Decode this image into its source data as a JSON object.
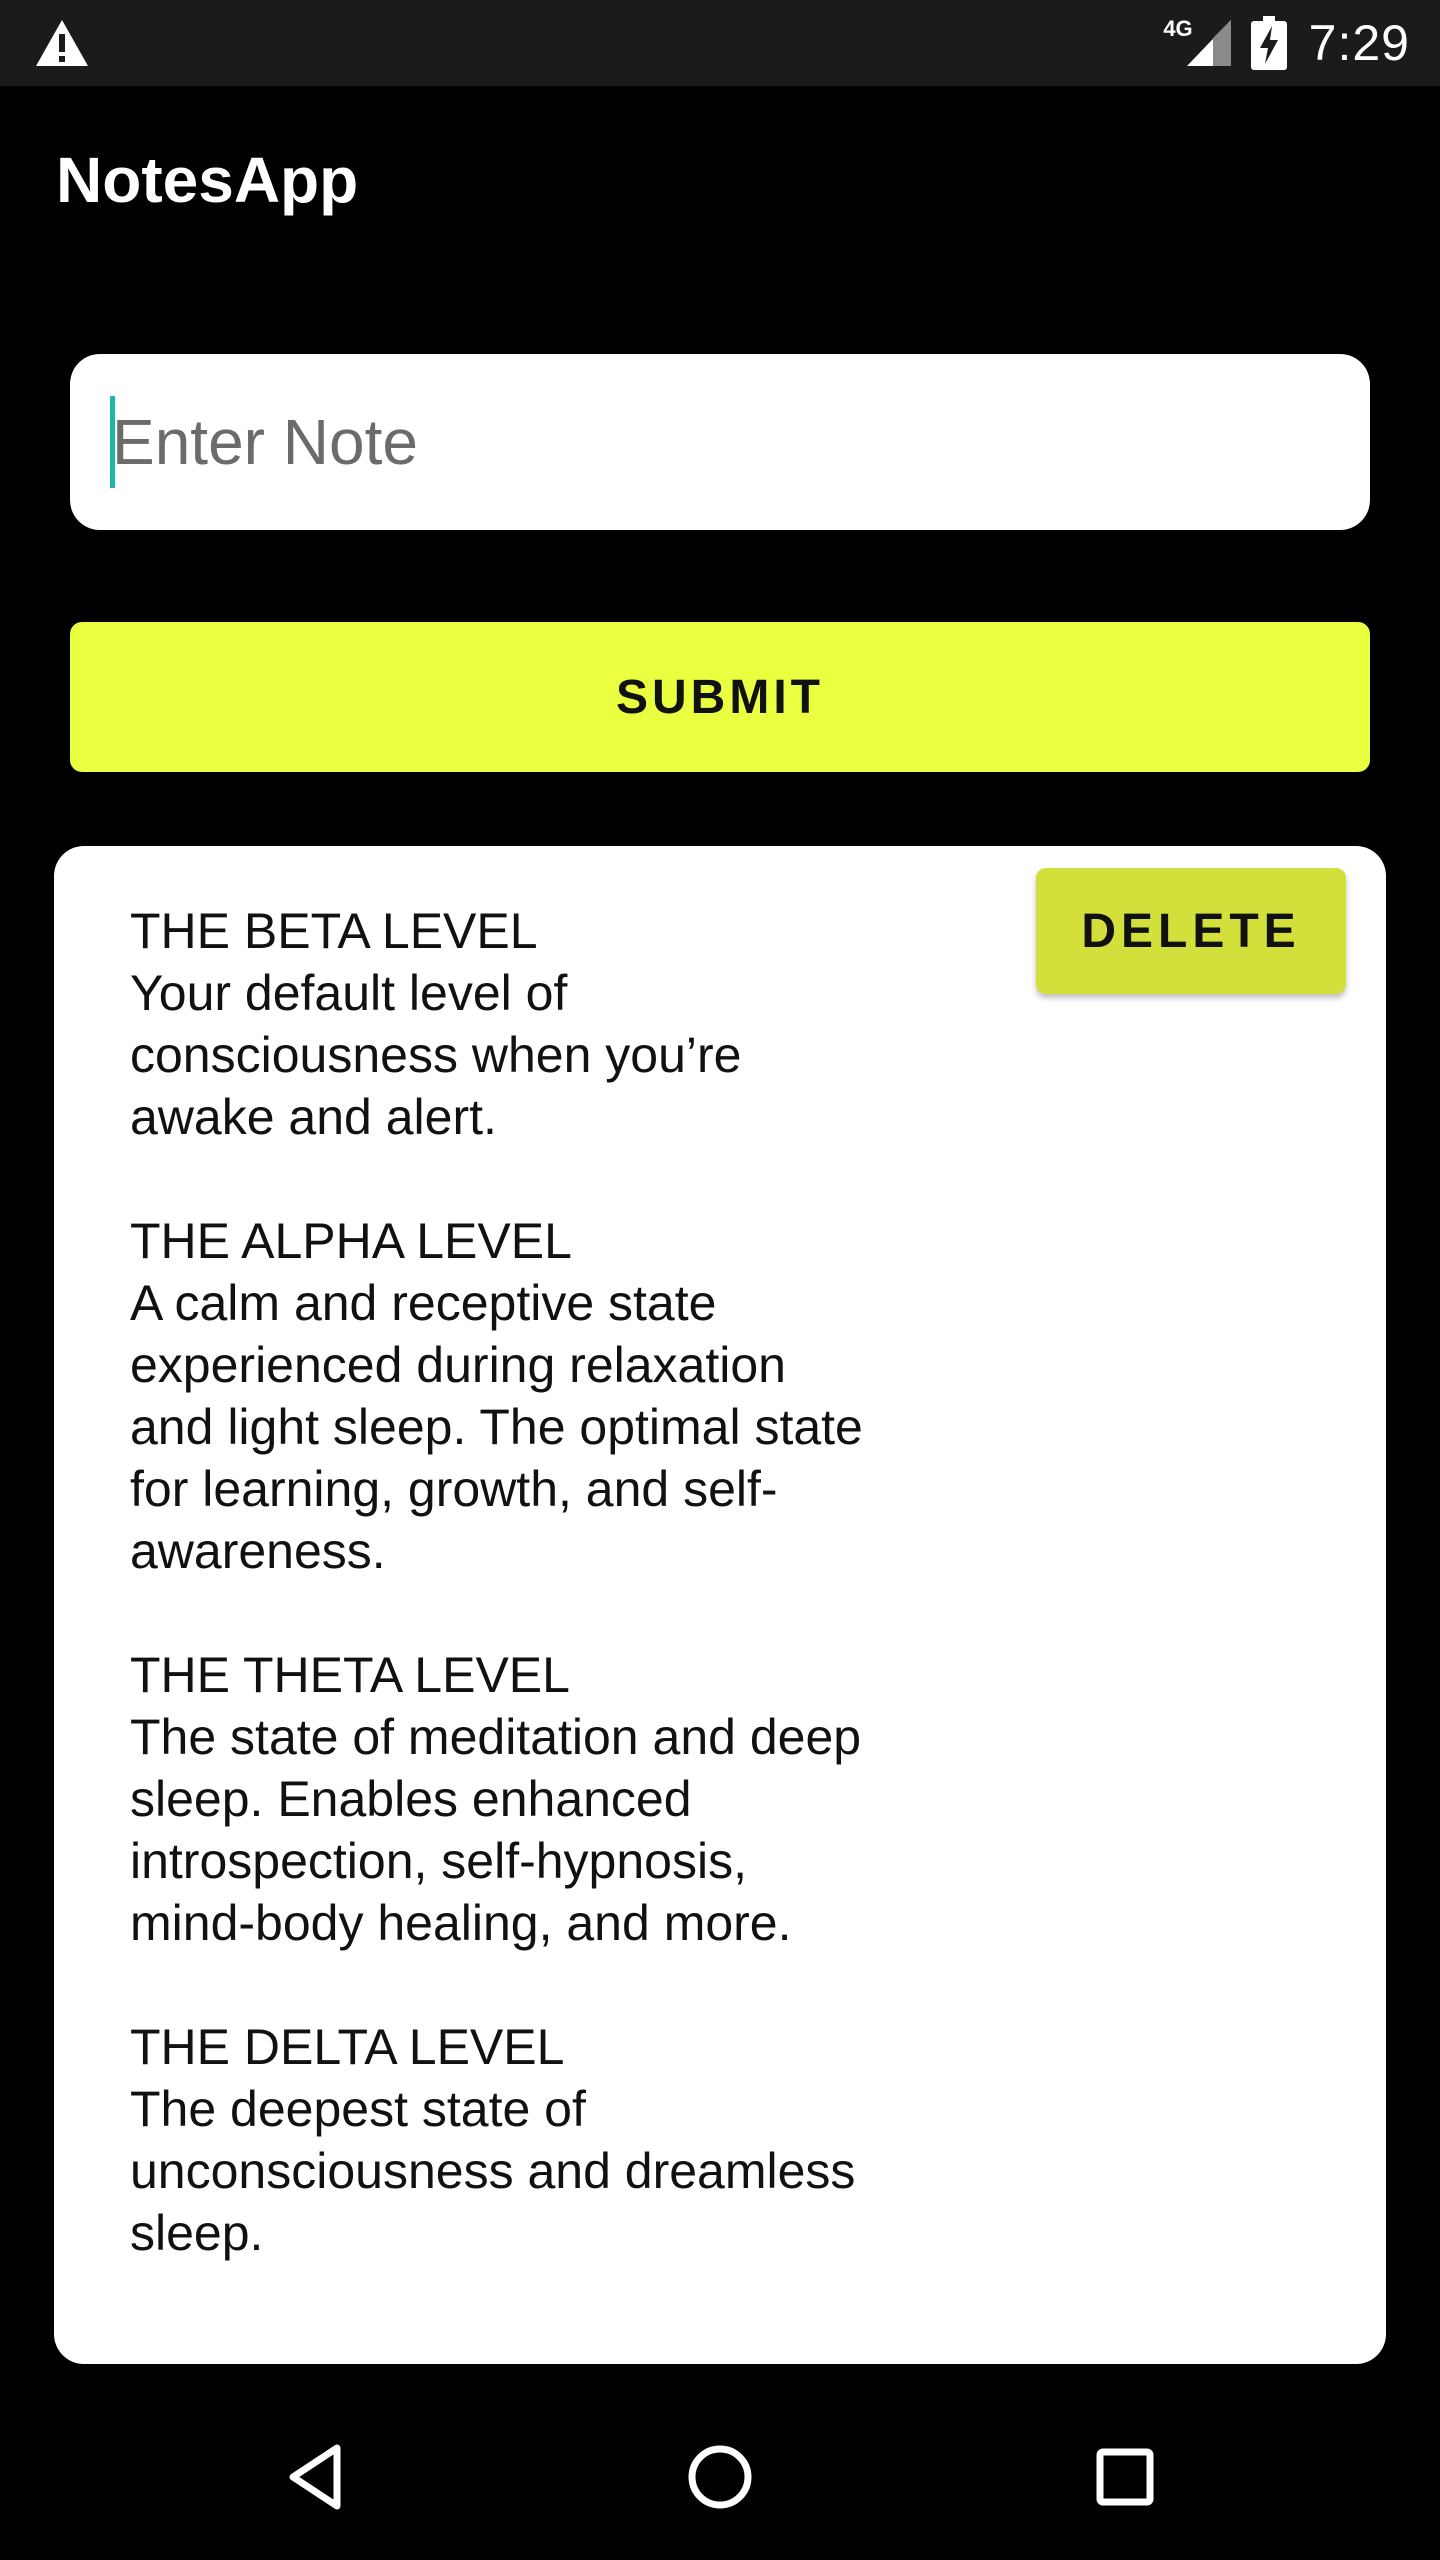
{
  "status_bar": {
    "network_type": "4G",
    "time": "7:29",
    "icons": [
      "warning-icon",
      "signal-icon",
      "battery-charging-icon"
    ]
  },
  "app_bar": {
    "title": "NotesApp"
  },
  "note_input": {
    "value": "",
    "placeholder": "Enter Note"
  },
  "submit_button": {
    "label": "SUBMIT"
  },
  "notes": [
    {
      "text": "THE BETA LEVEL\nYour default level of\nconsciousness when you’re\nawake and alert.\n\nTHE ALPHA LEVEL\nA calm and receptive state\nexperienced during relaxation\nand light sleep. The optimal state\nfor learning, growth, and self-\nawareness.\n\nTHE THETA LEVEL\nThe state of meditation and deep\nsleep. Enables enhanced\nintrospection, self-hypnosis,\nmind-body healing, and more.\n\nTHE DELTA LEVEL\nThe deepest state of\nunconsciousness and dreamless\nsleep.",
      "delete_label": "DELETE"
    }
  ],
  "nav_bar": {
    "icons": [
      "back-icon",
      "home-icon",
      "recents-icon"
    ]
  },
  "colors": {
    "background": "#000000",
    "status_bar": "#1b1b1b",
    "submit_button": "#eaff3f",
    "delete_button": "#d3df3a",
    "card": "#ffffff",
    "caret": "#1bb8a8"
  }
}
